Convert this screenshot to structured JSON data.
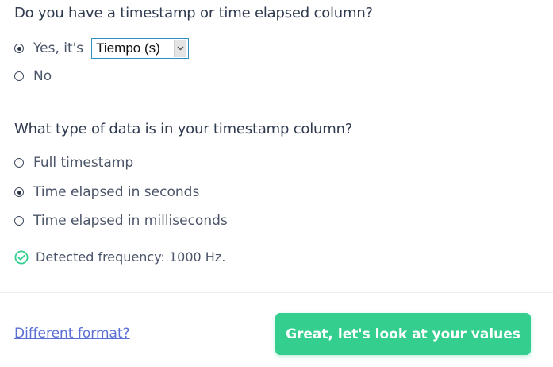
{
  "question_timestamp": {
    "title": "Do you have a timestamp or time elapsed column?",
    "options": [
      {
        "label": "Yes, it's",
        "selected": true
      },
      {
        "label": "No",
        "selected": false
      }
    ],
    "column_select": {
      "value": "Tiempo (s)",
      "dropdown_icon": "chevron-down-icon"
    }
  },
  "question_type": {
    "title": "What type of data is in your timestamp column?",
    "options": [
      {
        "label": "Full timestamp",
        "selected": false
      },
      {
        "label": "Time elapsed in seconds",
        "selected": true
      },
      {
        "label": "Time elapsed in milliseconds",
        "selected": false
      }
    ]
  },
  "detected": {
    "icon": "check-circle-icon",
    "text": "Detected frequency: 1000 Hz."
  },
  "footer": {
    "link_label": "Different format?",
    "cta_label": "Great, let's look at your values"
  },
  "colors": {
    "accent_green": "#34cf8e",
    "link_blue": "#5b6fd6",
    "select_border": "#2f8fc0"
  }
}
